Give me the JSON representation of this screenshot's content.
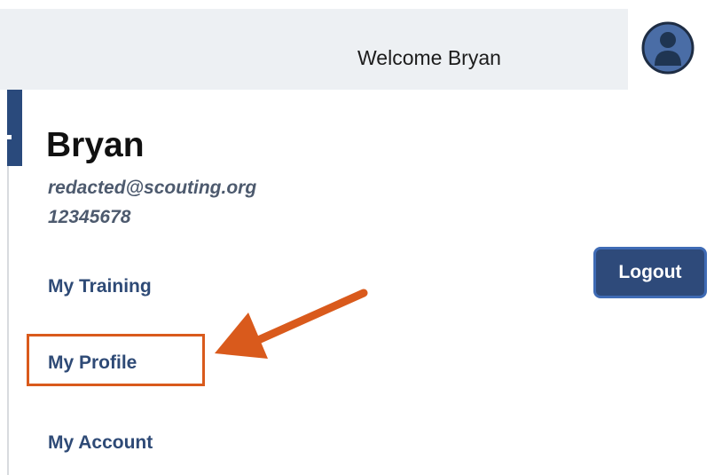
{
  "header": {
    "welcome_text": "Welcome Bryan",
    "avatar_icon": "user-avatar-icon"
  },
  "user": {
    "name": "Bryan",
    "email": "redacted@scouting.org",
    "member_id": "12345678"
  },
  "menu": {
    "items": [
      {
        "label": "My Training"
      },
      {
        "label": "My Profile",
        "highlighted": true
      },
      {
        "label": "My Account"
      }
    ],
    "logout_label": "Logout"
  },
  "annotation": {
    "highlight_color": "#d95a1c",
    "arrow_color": "#d95a1c"
  },
  "colors": {
    "header_bg": "#edf0f3",
    "link": "#2e4a76",
    "button_bg": "#2e4a7a",
    "button_border": "#3f6bb5"
  }
}
